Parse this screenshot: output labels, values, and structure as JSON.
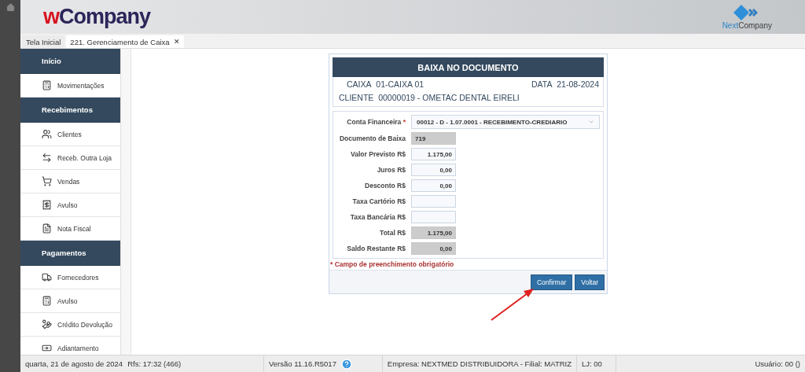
{
  "header": {
    "logo": {
      "prefix": "w",
      "name": "Company"
    },
    "brand": {
      "prefix": "Next",
      "name": "Company"
    }
  },
  "tabs": [
    {
      "label": "Tela Inicial",
      "selected": false
    },
    {
      "label": "221. Gerenciamento de Caixa",
      "selected": true,
      "close": "✕"
    }
  ],
  "sidebar": {
    "sections": [
      {
        "title": "Início",
        "items": [
          {
            "label": "Movimentações"
          }
        ]
      },
      {
        "title": "Recebimentos",
        "items": [
          {
            "label": "Clientes"
          },
          {
            "label": "Receb. Outra Loja"
          },
          {
            "label": "Vendas"
          },
          {
            "label": "Avulso"
          },
          {
            "label": "Nota Fiscal"
          }
        ]
      },
      {
        "title": "Pagamentos",
        "items": [
          {
            "label": "Fornecedores"
          },
          {
            "label": "Avulso"
          },
          {
            "label": "Crédito Devolução"
          },
          {
            "label": "Adiantamento"
          }
        ]
      }
    ]
  },
  "dialog": {
    "title": "BAIXA NO DOCUMENTO",
    "info": [
      {
        "label": "CAIXA",
        "value": "01-CAIXA 01",
        "side_label": "DATA",
        "side_value": "21-08-2024"
      },
      {
        "label": "CLIENTE",
        "value": "00000019 - OMETAC DENTAL EIRELI"
      }
    ],
    "account": {
      "label": "Conta Financeira",
      "required_mark": "*",
      "value": "00012 - D - 1.07.0001 - RECEBIMENTO-CREDIARIO"
    },
    "fields": [
      {
        "label": "Documento de Baixa",
        "value": "719",
        "readonly": true,
        "kind": "text"
      },
      {
        "label": "Valor Previsto R$",
        "value": "1.175,00",
        "readonly": false,
        "kind": "money"
      },
      {
        "label": "Juros R$",
        "value": "0,00",
        "readonly": false,
        "kind": "money"
      },
      {
        "label": "Desconto R$",
        "value": "0,00",
        "readonly": false,
        "kind": "money"
      },
      {
        "label": "Taxa Cartório R$",
        "readonly": false,
        "kind": "money"
      },
      {
        "label": "Taxa Bancária R$",
        "readonly": false,
        "kind": "money"
      },
      {
        "label": "Total R$",
        "value": "1.175,00",
        "readonly": true,
        "kind": "money"
      },
      {
        "label": "Saldo Restante R$",
        "value": "0,00",
        "readonly": true,
        "kind": "money"
      }
    ],
    "required_note": {
      "mark": "*",
      "text": "Campo de preenchimento obrigatório"
    },
    "buttons": [
      "Confirmar",
      "Voltar"
    ]
  },
  "status_bar": {
    "date": "quarta, 21 de agosto de 2024",
    "rfs": "Rfs: 17:32 (466)",
    "version": "Versão 11.16.R5017",
    "company": "Empresa: NEXTMED DISTRIBUIDORA - Filial: MATRIZ",
    "store": "LJ: 00",
    "user": "Usuário: 00 ()"
  }
}
